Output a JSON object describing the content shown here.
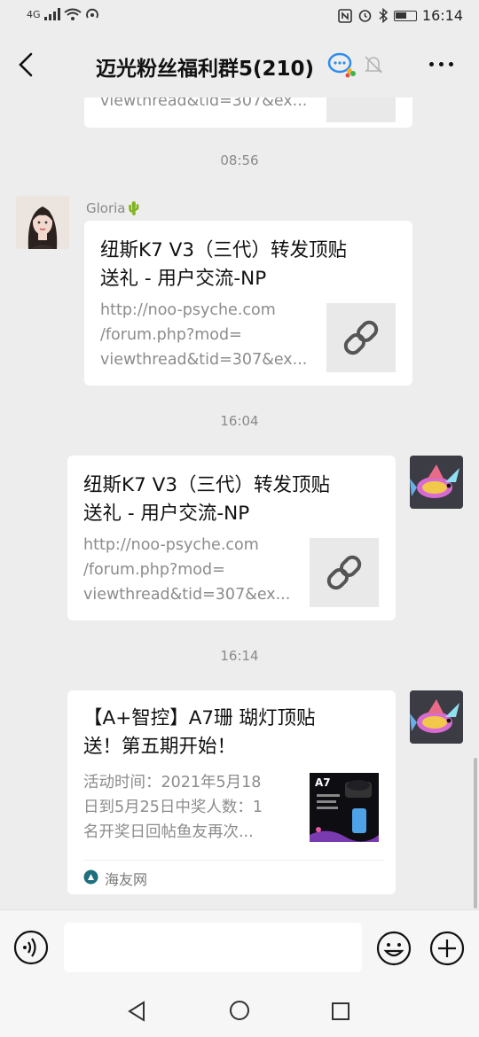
{
  "status_bar": {
    "network": "4G",
    "time": "16:14",
    "battery_level": 0.6
  },
  "header": {
    "title": "迈光粉丝福利群5(210)"
  },
  "messages": {
    "prev_card": {
      "desc_tail": "viewthread&tid=307&ex..."
    },
    "ts1": "08:56",
    "msg1": {
      "sender": "Gloria🌵",
      "title": "纽斯K7 V3（三代）转发顶贴\n送礼 - 用户交流-NP",
      "desc": "http://noo-psyche.com\n/forum.php?mod=\nviewthread&tid=307&ex..."
    },
    "ts2": "16:04",
    "msg2": {
      "title": "纽斯K7 V3（三代）转发顶贴\n送礼 - 用户交流-NP",
      "desc": "http://noo-psyche.com\n/forum.php?mod=\nviewthread&tid=307&ex..."
    },
    "ts3": "16:14",
    "msg3": {
      "title": "【A+智控】A7珊 瑚灯顶贴\n送！第五期开始！",
      "desc": "活动时间：2021年5月18\n日到5月25日中奖人数：1\n名开奖日回帖鱼友再次...",
      "thumb_label": "A7",
      "source": "海友网"
    }
  },
  "colors": {
    "background": "#ededed",
    "bubble": "#ffffff",
    "thumb": "#e9e9e9"
  },
  "icons": [
    "back-icon",
    "chat-badge-icon",
    "mute-icon",
    "more-icon",
    "link-icon",
    "voice-icon",
    "emoji-icon",
    "plus-icon"
  ]
}
